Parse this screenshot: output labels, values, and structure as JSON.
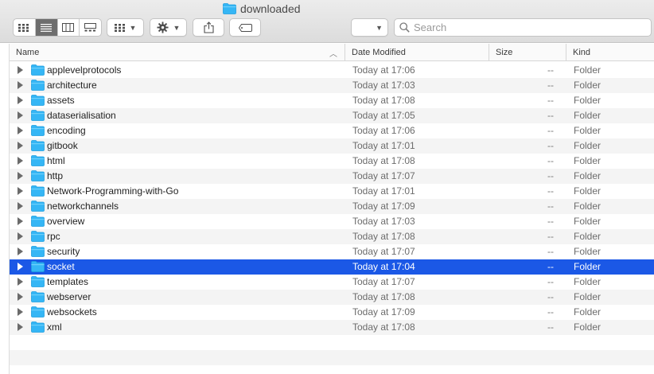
{
  "window": {
    "title": "downloaded"
  },
  "toolbar": {
    "view_buttons": [
      "icon-view",
      "list-view",
      "column-view",
      "gallery-view"
    ],
    "active_view": "list-view"
  },
  "search": {
    "placeholder": "Search",
    "value": ""
  },
  "columns": {
    "name": "Name",
    "date": "Date Modified",
    "size": "Size",
    "kind": "Kind"
  },
  "files": [
    {
      "name": "applevelprotocols",
      "date": "Today at 17:06",
      "size": "--",
      "kind": "Folder"
    },
    {
      "name": "architecture",
      "date": "Today at 17:03",
      "size": "--",
      "kind": "Folder"
    },
    {
      "name": "assets",
      "date": "Today at 17:08",
      "size": "--",
      "kind": "Folder"
    },
    {
      "name": "dataserialisation",
      "date": "Today at 17:05",
      "size": "--",
      "kind": "Folder"
    },
    {
      "name": "encoding",
      "date": "Today at 17:06",
      "size": "--",
      "kind": "Folder"
    },
    {
      "name": "gitbook",
      "date": "Today at 17:01",
      "size": "--",
      "kind": "Folder"
    },
    {
      "name": "html",
      "date": "Today at 17:08",
      "size": "--",
      "kind": "Folder"
    },
    {
      "name": "http",
      "date": "Today at 17:07",
      "size": "--",
      "kind": "Folder"
    },
    {
      "name": "Network-Programming-with-Go",
      "date": "Today at 17:01",
      "size": "--",
      "kind": "Folder"
    },
    {
      "name": "networkchannels",
      "date": "Today at 17:09",
      "size": "--",
      "kind": "Folder"
    },
    {
      "name": "overview",
      "date": "Today at 17:03",
      "size": "--",
      "kind": "Folder"
    },
    {
      "name": "rpc",
      "date": "Today at 17:08",
      "size": "--",
      "kind": "Folder"
    },
    {
      "name": "security",
      "date": "Today at 17:07",
      "size": "--",
      "kind": "Folder"
    },
    {
      "name": "socket",
      "date": "Today at 17:04",
      "size": "--",
      "kind": "Folder",
      "selected": true
    },
    {
      "name": "templates",
      "date": "Today at 17:07",
      "size": "--",
      "kind": "Folder"
    },
    {
      "name": "webserver",
      "date": "Today at 17:08",
      "size": "--",
      "kind": "Folder"
    },
    {
      "name": "websockets",
      "date": "Today at 17:09",
      "size": "--",
      "kind": "Folder"
    },
    {
      "name": "xml",
      "date": "Today at 17:08",
      "size": "--",
      "kind": "Folder"
    }
  ],
  "colors": {
    "selection": "#1b58e6",
    "folder": "#35b6f5",
    "folder_dark": "#1e9fe0"
  }
}
